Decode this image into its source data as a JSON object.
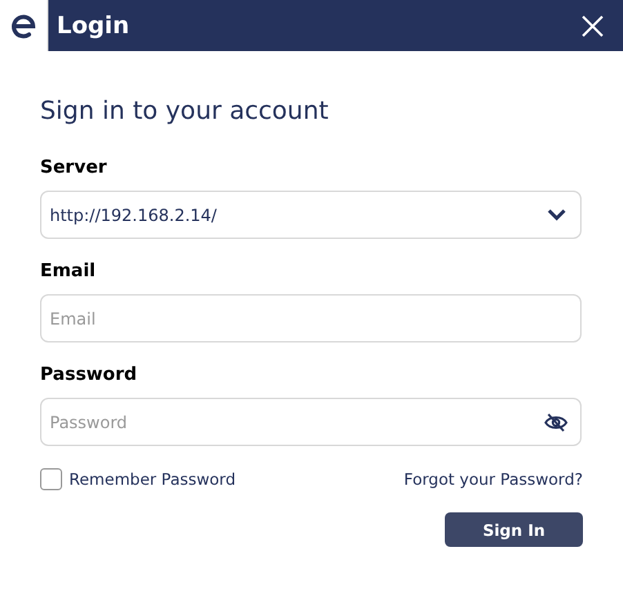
{
  "window": {
    "title": "Login"
  },
  "heading": "Sign in to your account",
  "server": {
    "label": "Server",
    "value": "http://192.168.2.14/"
  },
  "email": {
    "label": "Email",
    "placeholder": "Email"
  },
  "password": {
    "label": "Password",
    "placeholder": "Password"
  },
  "remember": {
    "label": "Remember Password",
    "checked": false
  },
  "forgot_link": "Forgot your Password?",
  "buttons": [
    "Sign In"
  ]
}
